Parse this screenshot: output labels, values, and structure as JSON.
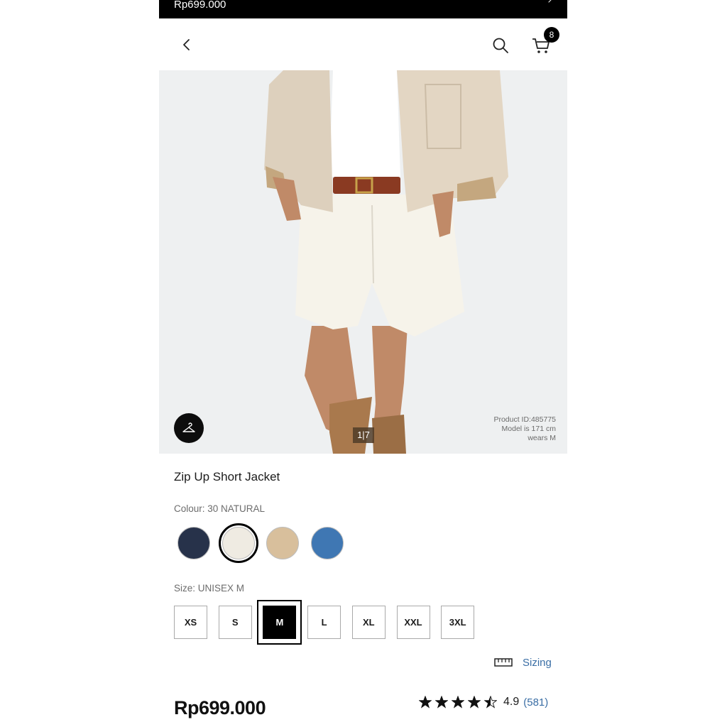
{
  "top_bar": {
    "price": "Rp699.000"
  },
  "header": {
    "cart_count": "8"
  },
  "gallery": {
    "pager": "1|7",
    "product_id": "Product ID:485775",
    "model_line1": "Model is 171 cm",
    "model_line2": "wears M"
  },
  "product": {
    "title": "Zip Up Short Jacket",
    "colour_label": "Colour: 30 NATURAL",
    "colours": [
      {
        "hex": "#27324a"
      },
      {
        "hex": "#efebe2",
        "selected": true
      },
      {
        "hex": "#d8bf9c"
      },
      {
        "hex": "#3f77b3"
      }
    ],
    "size_label": "Size: UNISEX M",
    "sizes": [
      "XS",
      "S",
      "M",
      "L",
      "XL",
      "XXL",
      "3XL"
    ],
    "selected_size": "M",
    "sizing_link": "Sizing",
    "price": "Rp699.000",
    "rating_value": "4.9",
    "rating_count": "(581)",
    "rating_stars": 4.5
  },
  "colors": {
    "link": "#3a6ea5",
    "accent": "#000000"
  }
}
